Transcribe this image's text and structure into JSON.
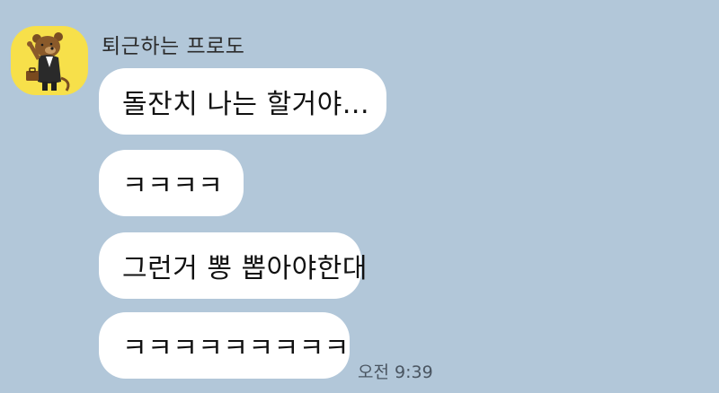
{
  "chat": {
    "sender": {
      "name": "퇴근하는 프로도",
      "avatar_icon": "frodo-character-avatar"
    },
    "messages": [
      {
        "text": "돌잔치 나는 할거야..."
      },
      {
        "text": "ㅋㅋㅋㅋ"
      },
      {
        "text": "그런거 뽕 뽑아야한대"
      },
      {
        "text": "ㅋㅋㅋㅋㅋㅋㅋㅋㅋ"
      }
    ],
    "timestamp": "오전 9:39"
  },
  "colors": {
    "background": "#b2c7d9",
    "bubble": "#ffffff",
    "avatar_background": "#f7e04a"
  }
}
